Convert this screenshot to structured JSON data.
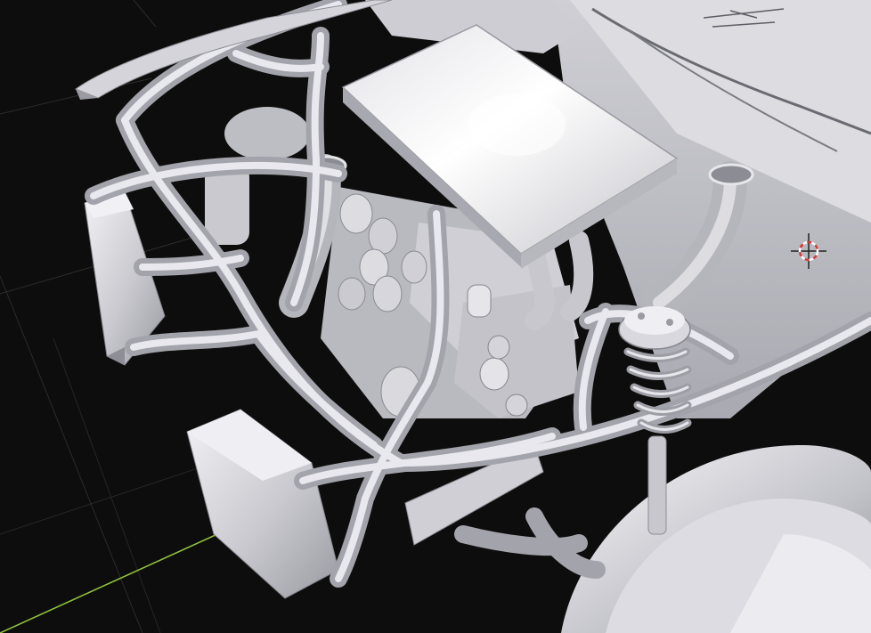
{
  "viewport": {
    "background_color": "#0d0d0d",
    "grid_line_color": "#2c2c2c",
    "x_axis_color": "#8fbf3a",
    "model_shade_light": "#e9e9ee",
    "model_shade_mid": "#c6c6cc",
    "model_shade_dark": "#8e8e96"
  },
  "cursor": {
    "icon": "3d-cursor-icon",
    "ring_color_a": "#d93a3a",
    "ring_color_b": "#ffffff"
  }
}
